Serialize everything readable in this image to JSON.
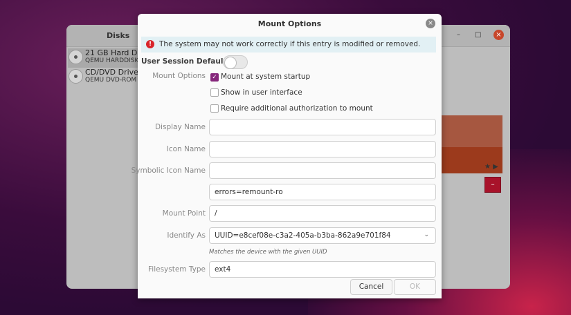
{
  "disks_window": {
    "title": "Disks",
    "drives": [
      {
        "name": "21 GB Hard Disk",
        "model": "QEMU HARDDISK"
      },
      {
        "name": "CD/DVD Drive",
        "model": "QEMU DVD-ROM"
      }
    ],
    "minimize": "–",
    "maximize": "□",
    "close": "×",
    "star": "★",
    "play": "▶",
    "delete": "–"
  },
  "dialog": {
    "title": "Mount Options",
    "close": "×",
    "warning": "The system may not work correctly if this entry is modified or removed.",
    "warning_icon": "!",
    "user_session_defaults": "User Session Defaults",
    "user_session_defaults_on": false,
    "mount_options_label": "Mount Options",
    "checkboxes": [
      {
        "label": "Mount at system startup",
        "checked": true
      },
      {
        "label": "Show in user interface",
        "checked": false
      },
      {
        "label": "Require additional authorization to mount",
        "checked": false
      }
    ],
    "display_name_label": "Display Name",
    "display_name": "",
    "icon_name_label": "Icon Name",
    "icon_name": "",
    "symbolic_icon_name_label": "Symbolic Icon Name",
    "symbolic_icon_name": "",
    "options": "errors=remount-ro",
    "mount_point_label": "Mount Point",
    "mount_point": "/",
    "identify_as_label": "Identify As",
    "identify_as": "UUID=e8cef08e-c3a2-405a-b3ba-862a9e701f84",
    "identify_hint": "Matches the device with the given UUID",
    "fs_type_label": "Filesystem Type",
    "fs_type": "ext4",
    "cancel": "Cancel",
    "ok": "OK"
  }
}
